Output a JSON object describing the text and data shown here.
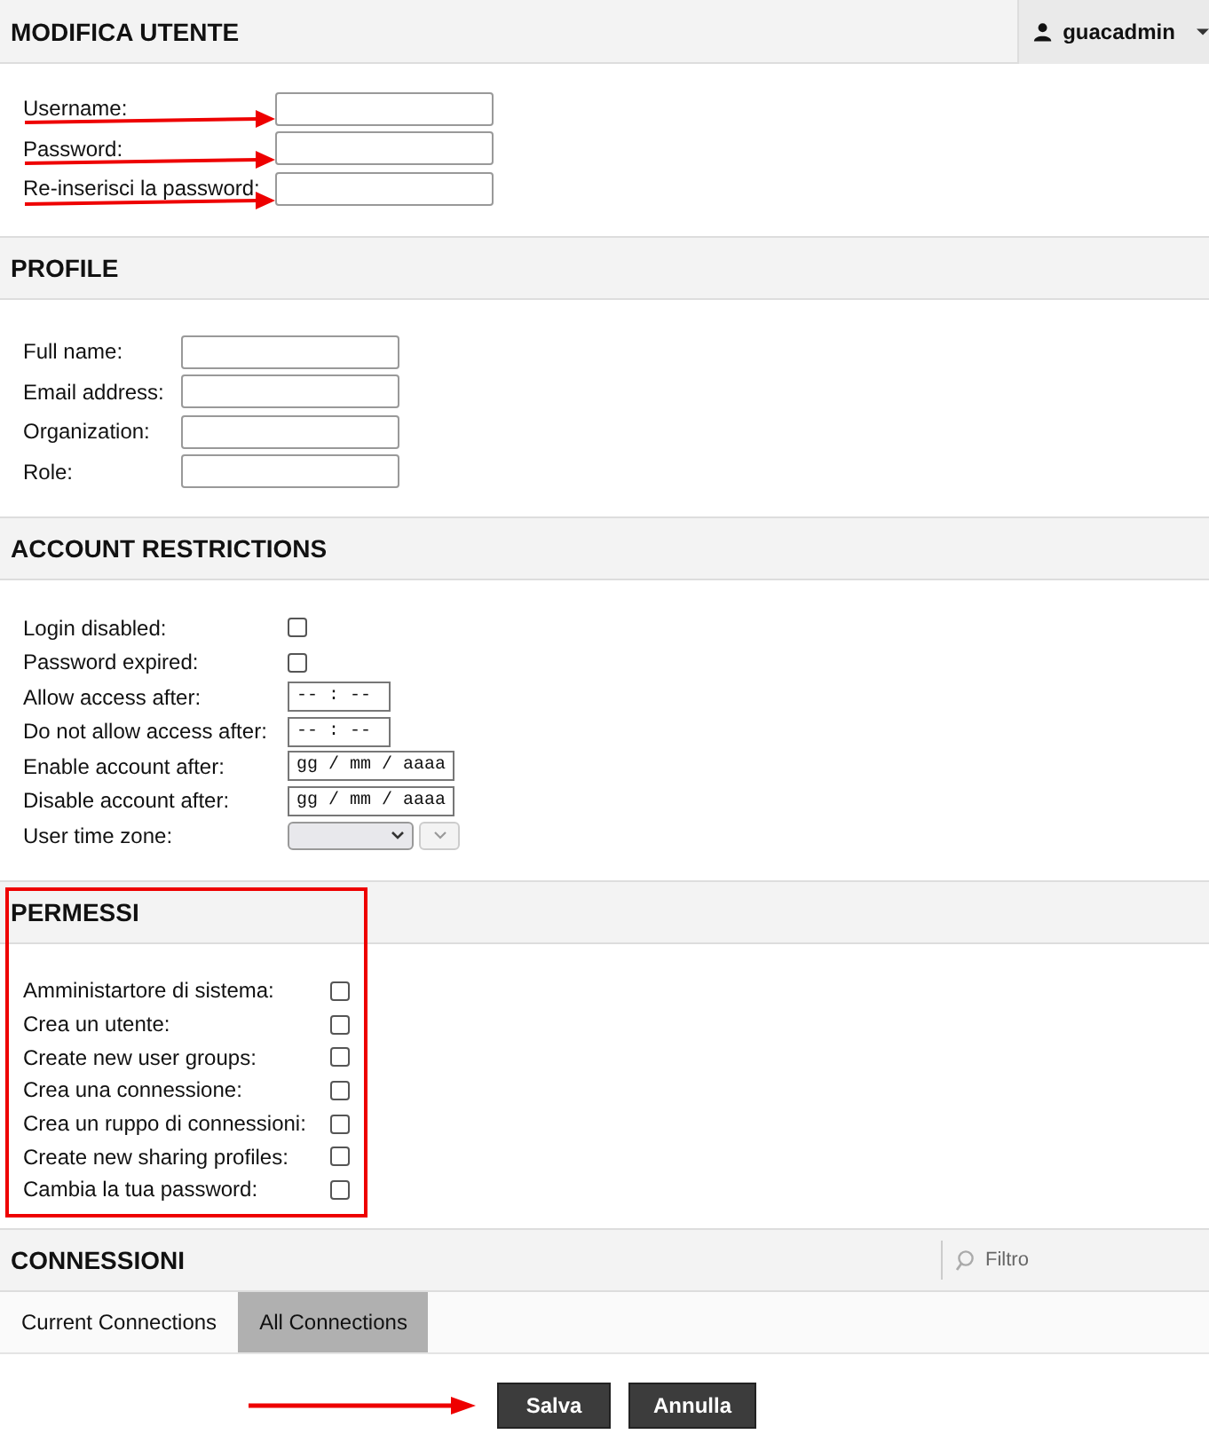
{
  "header": {
    "title": "MODIFICA UTENTE",
    "user": "guacadmin"
  },
  "login_fields": [
    {
      "label": "Username:"
    },
    {
      "label": "Password:"
    },
    {
      "label": "Re-inserisci la password:"
    }
  ],
  "profile": {
    "title": "PROFILE",
    "fields": [
      {
        "label": "Full name:"
      },
      {
        "label": "Email address:"
      },
      {
        "label": "Organization:"
      },
      {
        "label": "Role:"
      }
    ]
  },
  "restrictions": {
    "title": "ACCOUNT RESTRICTIONS",
    "rows": [
      {
        "kind": "checkbox",
        "label": "Login disabled:",
        "checked": false
      },
      {
        "kind": "checkbox",
        "label": "Password expired:",
        "checked": false
      },
      {
        "kind": "time",
        "label": "Allow access after:",
        "value": "-- : --"
      },
      {
        "kind": "time",
        "label": "Do not allow access after:",
        "value": "-- : --"
      },
      {
        "kind": "date",
        "label": "Enable account after:",
        "value": "gg / mm / aaaa"
      },
      {
        "kind": "date",
        "label": "Disable account after:",
        "value": "gg / mm / aaaa"
      },
      {
        "kind": "select",
        "label": "User time zone:"
      }
    ]
  },
  "permissions": {
    "title": "PERMESSI",
    "items": [
      {
        "label": "Amministartore di sistema:",
        "checked": false
      },
      {
        "label": "Crea un utente:",
        "checked": false
      },
      {
        "label": "Create new user groups:",
        "checked": false
      },
      {
        "label": "Crea una connessione:",
        "checked": false
      },
      {
        "label": "Crea un ruppo di connessioni:",
        "checked": false
      },
      {
        "label": "Create new sharing profiles:",
        "checked": false
      },
      {
        "label": "Cambia la tua password:",
        "checked": false
      }
    ]
  },
  "connections": {
    "title": "CONNESSIONI",
    "filter": {
      "placeholder": "Filtro"
    },
    "tabs": [
      {
        "label": "Current Connections",
        "selected": false
      },
      {
        "label": "All Connections",
        "selected": true
      }
    ]
  },
  "buttons": [
    "Salva",
    "Annulla"
  ]
}
